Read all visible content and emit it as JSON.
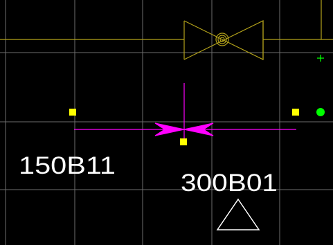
{
  "canvas": {
    "background": "#000000"
  },
  "colors": {
    "grid": "#6e6e6e",
    "valve": "#b3a21a",
    "magenta": "#ff00ff",
    "grip": "#ffff00",
    "snap": "#00ff00",
    "label": "#ffffff"
  },
  "labels": {
    "tag_left": "150B11",
    "tag_right": "300B01"
  },
  "icons": {
    "valve": "check-valve-icon",
    "reducer": "reducer-icon",
    "north": "triangle-marker-icon",
    "snap": "snap-crosshair-icon"
  }
}
